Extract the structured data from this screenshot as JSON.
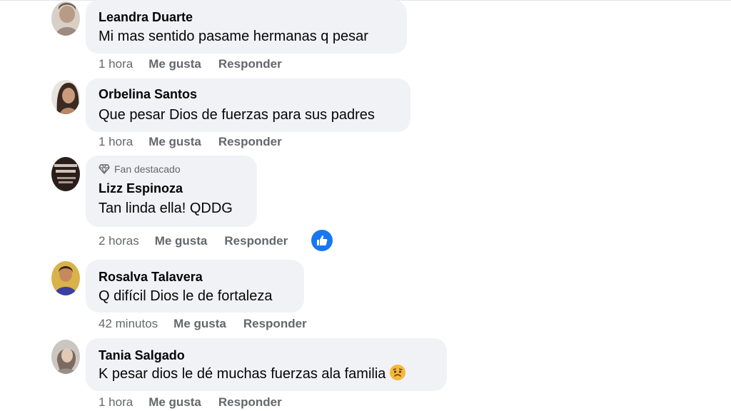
{
  "comments": [
    {
      "author": "Leandra Duarte",
      "text": "Mi mas sentido pasame hermanas q pesar",
      "time": "1 hora",
      "like_label": "Me gusta",
      "reply_label": "Responder"
    },
    {
      "author": "Orbelina Santos",
      "text": "Que pesar Dios de fuerzas para sus padres",
      "time": "1 hora",
      "like_label": "Me gusta",
      "reply_label": "Responder"
    },
    {
      "author": "Lizz Espinoza",
      "badge": "Fan destacado",
      "text": "Tan linda ella! QDDG",
      "time": "2 horas",
      "like_label": "Me gusta",
      "reply_label": "Responder",
      "reaction": "like-icon"
    },
    {
      "author": "Rosalva Talavera",
      "text": "Q difícil Dios le de fortaleza",
      "time": "42 minutos",
      "like_label": "Me gusta",
      "reply_label": "Responder"
    },
    {
      "author": "Tania Salgado",
      "text": "K pesar dios le dé muchas fuerzas ala familia",
      "emoji": "sad-face-emoji",
      "time": "1 hora",
      "like_label": "Me gusta",
      "reply_label": "Responder"
    }
  ],
  "colors": {
    "bubble": "#f0f2f5",
    "secondary_text": "#65676b",
    "like_blue": "#1877f2"
  }
}
